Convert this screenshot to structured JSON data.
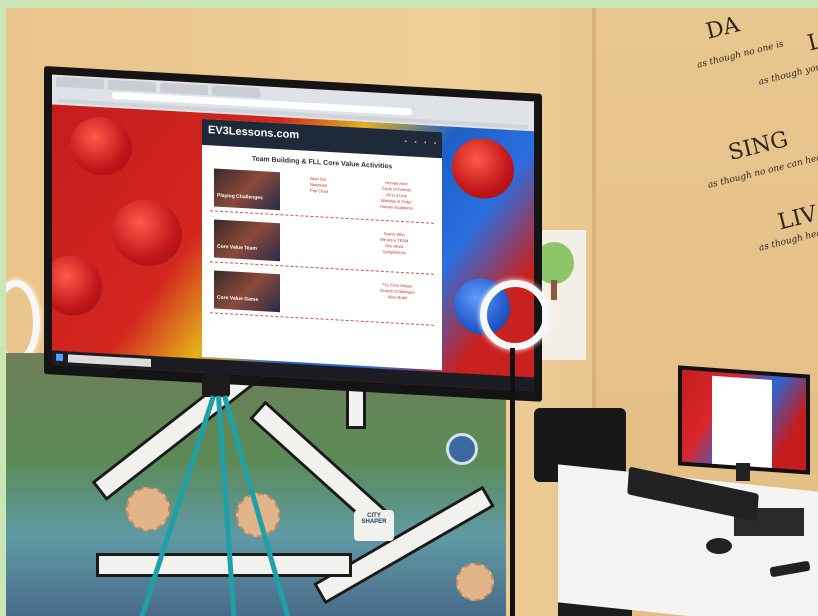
{
  "photo": {
    "subject": "Robotics classroom with large TV, tripod camera, ring lights, FLL map and desktop monitor"
  },
  "wall_decal": {
    "line1": "DA",
    "line1_sub": "as though no one is",
    "line2": "L",
    "line2_sub": "as though you",
    "line3": "SING",
    "line3_sub": "as though no one can hear you",
    "line4": "LIV",
    "line4_sub": "as though heaven"
  },
  "tv_page": {
    "site_logo": "EV3Lessons.com",
    "page_title": "Team Building & FLL Core Value Activities",
    "row1_thumb_label": "Playing Challenges",
    "row1_links": [
      "Alien Dot",
      "Notebook",
      "Pop Chart"
    ],
    "row1_links2": [
      "Human Knot",
      "Circle of Friends",
      "All in a Line",
      "Birthday in Order",
      "Human Sculptures"
    ],
    "row2_thumb_label": "Core Value Team",
    "row2_links2": [
      "Guess Who",
      "We are a TEAM",
      "One Word",
      "Compliments"
    ],
    "row3_thumb_label": "Core Value Game",
    "row3_links2": [
      "FLL Core Values",
      "Scratch Challenges",
      "Alien Build"
    ]
  },
  "mat": {
    "badge_top": "CITY",
    "badge_bottom": "SHAPER"
  },
  "colors": {
    "wall": "#eccc96",
    "tv_frame": "#141414",
    "lego_red": "#c41d1d",
    "lego_blue": "#2a6fe0",
    "tripod_leg": "#1fa0a8",
    "frame_border": "#c9e6b4"
  }
}
